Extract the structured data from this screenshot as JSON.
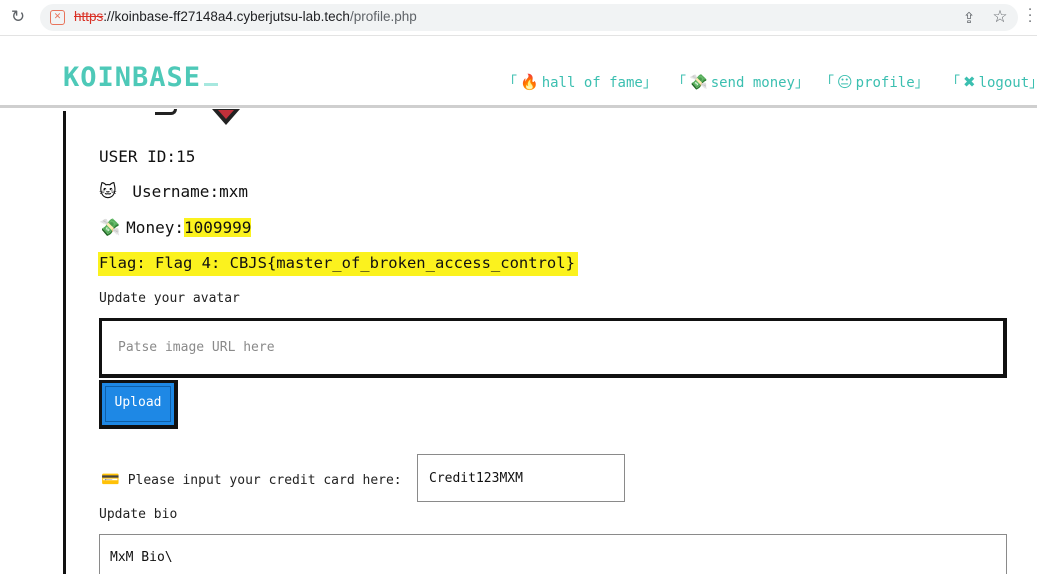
{
  "browser": {
    "url_scheme": "https",
    "url_host": "://koinbase-ff27148a4.cyberjutsu-lab.tech",
    "url_path": "/profile.php",
    "reload_icon": "reload-icon",
    "share_icon": "share-icon",
    "star_icon": "star-icon"
  },
  "header": {
    "logo": "KOINBASE",
    "nav": {
      "fame": {
        "open": "「",
        "emoji": "🔥",
        "label": "hall of fame",
        "close": "」"
      },
      "send": {
        "open": "「",
        "emoji": "💸",
        "label": "send money",
        "close": "」"
      },
      "profile": {
        "open": "「",
        "emoji": "😐",
        "label": "profile",
        "close": "」"
      },
      "logout": {
        "open": "「",
        "emoji": "✖",
        "label": "logout",
        "close": "」"
      }
    }
  },
  "profile": {
    "user_id_label": "USER ID:",
    "user_id": "15",
    "username_icon": "🐱",
    "username_label": "Username:",
    "username": "mxm",
    "money_icon": "💸",
    "money_label": "Money:",
    "money": "1009999",
    "flag_text": "Flag: Flag 4: CBJS{master_of_broken_access_control}"
  },
  "avatar": {
    "label": "Update your avatar",
    "placeholder": "Patse image URL here",
    "upload_label": "Upload"
  },
  "credit_card": {
    "icon": "💳",
    "label": "Please input your credit card here:",
    "value": "Credit123MXM"
  },
  "bio": {
    "label": "Update bio",
    "value": "MxM Bio\\"
  },
  "colors": {
    "accent": "#4ec9b8",
    "highlight": "#fbf21e",
    "upload_button": "#1e88e5"
  }
}
